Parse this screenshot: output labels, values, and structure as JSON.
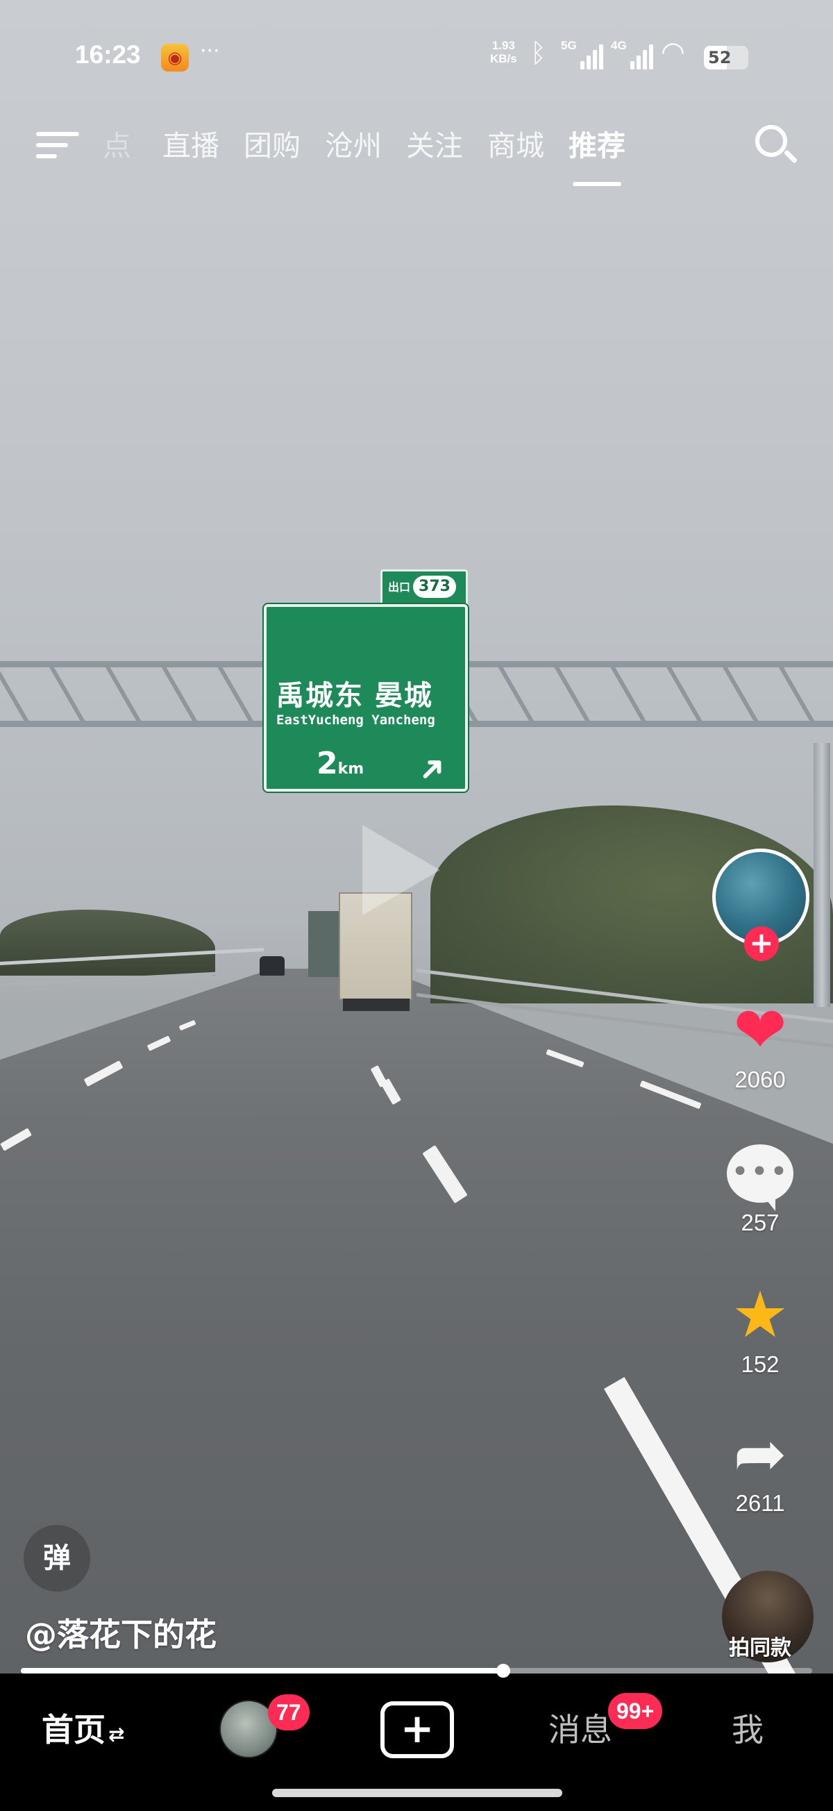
{
  "status_bar": {
    "time": "16:23",
    "notification_icon": "weibo-icon",
    "more": "···",
    "net_speed_value": "1.93",
    "net_speed_unit": "KB/s",
    "signal1_label": "5G",
    "signal2_label": "4G",
    "battery": "52",
    "battery_level": 52
  },
  "top_nav": {
    "tabs": [
      "点",
      "直播",
      "团购",
      "沧州",
      "关注",
      "商城",
      "推荐"
    ],
    "active_tab": "推荐"
  },
  "video": {
    "sign_exit_label": "出口",
    "sign_exit_number": "373",
    "sign_destinations_cn": "禹城东 晏城",
    "sign_destinations_en": "EastYucheng   Yancheng",
    "sign_distance": "2",
    "sign_distance_unit": "km"
  },
  "actions": {
    "likes": "2060",
    "comments": "257",
    "favorites": "152",
    "shares": "2611"
  },
  "author": {
    "handle": "@落花下的花"
  },
  "danmu_toggle": "弹",
  "same_style": "拍同款",
  "progress": 0.61,
  "bottom_tabs": {
    "home": "首页",
    "friends_badge": "77",
    "create": "+",
    "messages": "消息",
    "messages_badge": "99+",
    "me": "我"
  },
  "colors": {
    "accent": "#fe2c55",
    "favorite": "#fcb817",
    "sign_green": "#1f8a59"
  }
}
